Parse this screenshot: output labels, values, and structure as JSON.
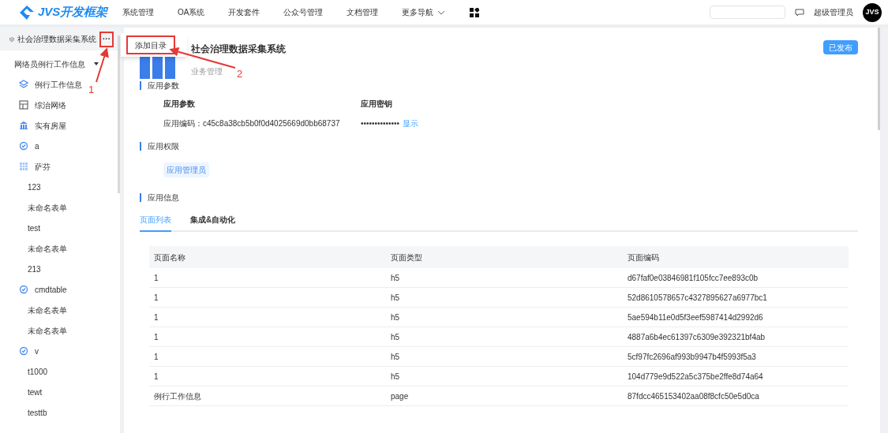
{
  "logo": {
    "text": "JVS开发框架"
  },
  "nav": [
    {
      "label": "系统管理",
      "has_caret": false
    },
    {
      "label": "OA系统",
      "has_caret": false
    },
    {
      "label": "开发套件",
      "has_caret": false
    },
    {
      "label": "公众号管理",
      "has_caret": false
    },
    {
      "label": "文档管理",
      "has_caret": false
    },
    {
      "label": "更多导航",
      "has_caret": true
    }
  ],
  "user": {
    "name": "超级管理员",
    "avatar": "JVS"
  },
  "sidebar": {
    "title": "社会治理数据采集系统",
    "more": "···",
    "group": {
      "label": "网络员例行工作信息",
      "expanded": true
    },
    "items": [
      {
        "label": "例行工作信息",
        "kind": "layers"
      },
      {
        "label": "综治网络",
        "kind": "table"
      },
      {
        "label": "实有房屋",
        "kind": "bank"
      },
      {
        "label": "a",
        "kind": "badge"
      },
      {
        "label": "萨芬",
        "kind": "grid"
      },
      {
        "label": "123",
        "kind": "page"
      },
      {
        "label": "未命名表单",
        "kind": "page"
      },
      {
        "label": "test",
        "kind": "page"
      },
      {
        "label": "未命名表单",
        "kind": "page"
      },
      {
        "label": "213",
        "kind": "page"
      },
      {
        "label": "cmdtable",
        "kind": "badge"
      },
      {
        "label": "未命名表单",
        "kind": "page"
      },
      {
        "label": "未命名表单",
        "kind": "page"
      },
      {
        "label": "v",
        "kind": "badge"
      },
      {
        "label": "t1000",
        "kind": "page"
      },
      {
        "label": "tewt",
        "kind": "page"
      },
      {
        "label": "testtb",
        "kind": "page"
      }
    ]
  },
  "popup_menu": {
    "items": [
      "添加目录"
    ]
  },
  "app": {
    "name": "社会治理数据采集系统",
    "subtitle": "业务管理",
    "status": "已发布"
  },
  "params": {
    "heading": "应用参数",
    "col1": "应用参数",
    "col2": "应用密钥",
    "code": "应用编码：c45c8a38cb5b0f0d4025669d0bb68737",
    "secret": "••••••••••••••",
    "show": "显示"
  },
  "permissions": {
    "heading": "应用权限",
    "tags": [
      "应用管理员"
    ]
  },
  "info": {
    "heading": "应用信息",
    "tabs": [
      {
        "label": "页面列表",
        "selected": true
      },
      {
        "label": "集成&自动化",
        "selected": false
      }
    ]
  },
  "table": {
    "columns": [
      "页面名称",
      "页面类型",
      "页面编码"
    ],
    "rows": [
      [
        "1",
        "h5",
        "d67faf0e03846981f105fcc7ee893c0b"
      ],
      [
        "1",
        "h5",
        "52d8610578657c4327895627a6977bc1"
      ],
      [
        "1",
        "h5",
        "5ae594b11e0d5f3eef5987414d2992d6"
      ],
      [
        "1",
        "h5",
        "4887a6b4ec61397c6309e392321bf4ab"
      ],
      [
        "1",
        "h5",
        "5cf97fc2696af993b9947b4f5993f5a3"
      ],
      [
        "1",
        "h5",
        "104d779e9d522a5c375be2ffe8d74a64"
      ],
      [
        "例行工作信息",
        "page",
        "87fdcc465153402aa08f8cfc50e5d0ca"
      ]
    ]
  },
  "annotations": [
    "1",
    "2"
  ]
}
